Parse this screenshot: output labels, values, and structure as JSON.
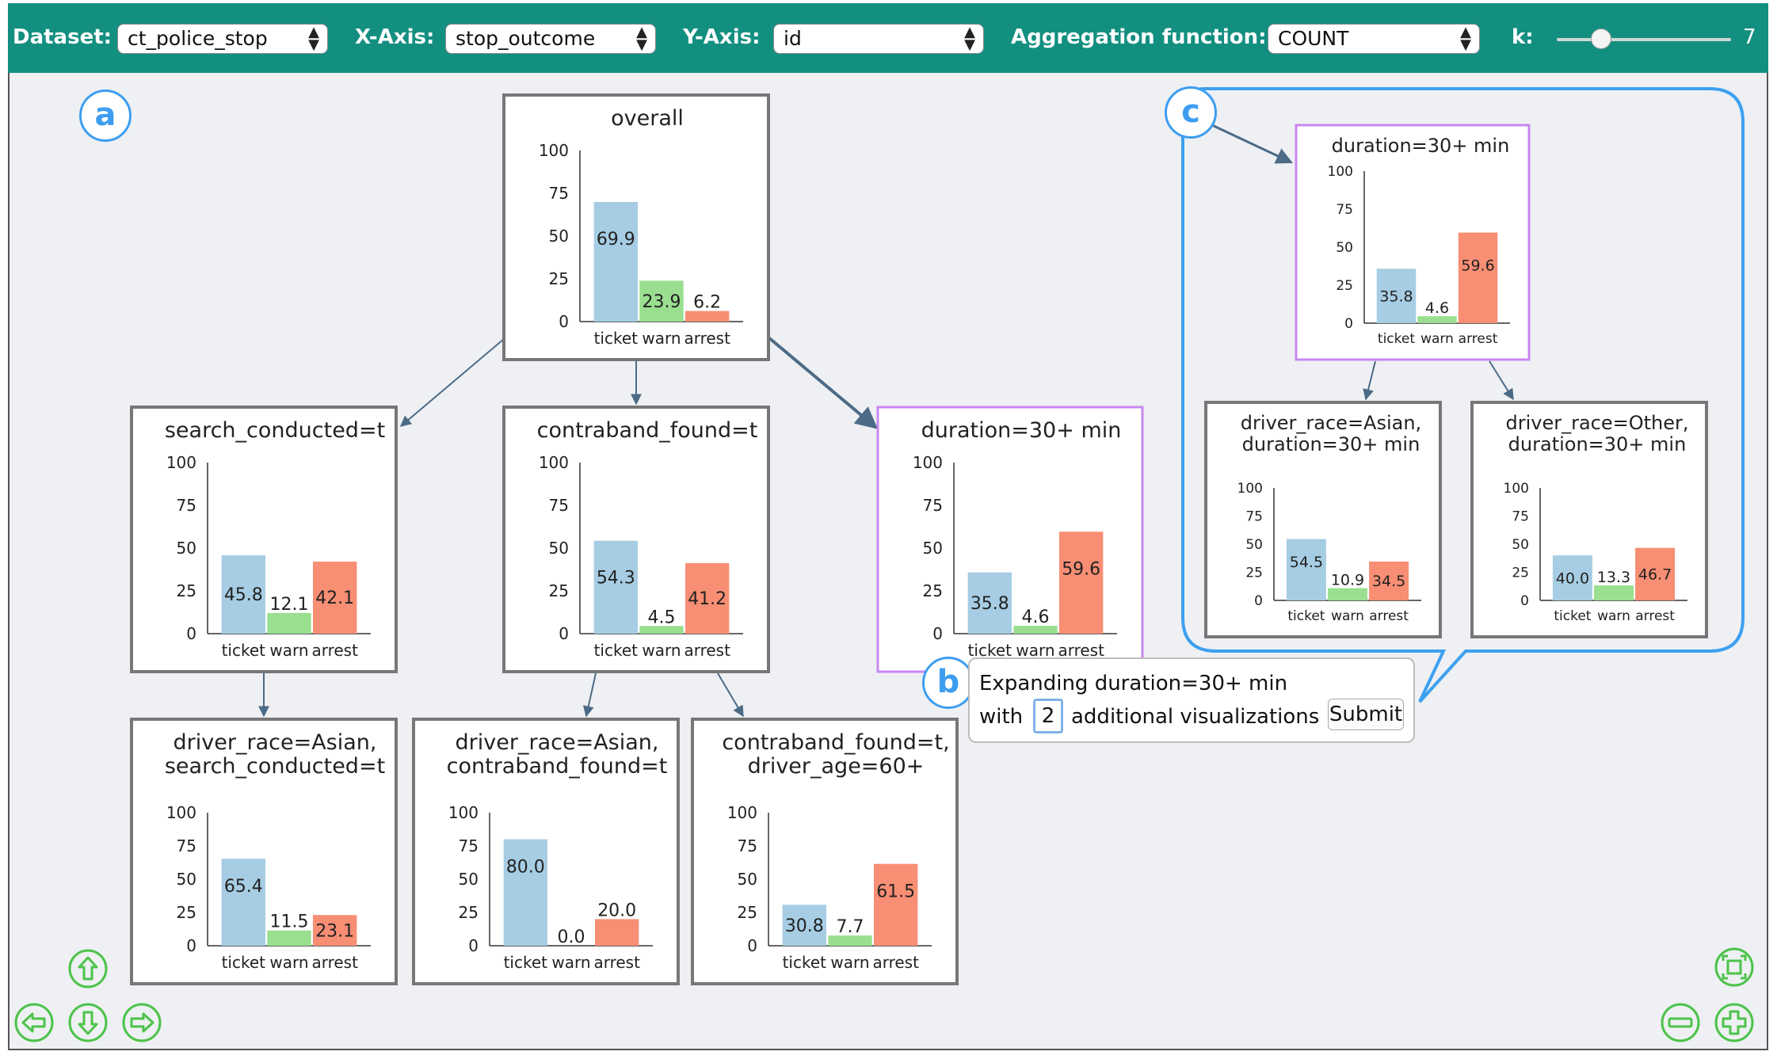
{
  "toolbar": {
    "dataset_label": "Dataset:",
    "dataset_value": "ct_police_stop",
    "xaxis_label": "X-Axis:",
    "xaxis_value": "stop_outcome",
    "yaxis_label": "Y-Axis:",
    "yaxis_value": "id",
    "agg_label": "Aggregation function:",
    "agg_value": "COUNT",
    "k_label": "k:",
    "k_value": "7"
  },
  "annotations": {
    "a": "a",
    "b": "b",
    "c": "c"
  },
  "popup": {
    "line1": "Expanding duration=30+ min",
    "with": "with",
    "count": "2",
    "after": "additional visualizations",
    "submit": "Submit"
  },
  "colors": {
    "ticket": "#a6cde3",
    "warn": "#99df8f",
    "arrest": "#f88e74",
    "node_border": "#777777",
    "highlight": "#c987f0",
    "expansion": "#3da0f0",
    "edge": "#4c6b86",
    "toolbar": "#138f80"
  },
  "chart_data": [
    {
      "id": "overall",
      "type": "bar",
      "title": [
        "overall"
      ],
      "categories": [
        "ticket",
        "warn",
        "arrest"
      ],
      "values": [
        69.9,
        23.9,
        6.2
      ],
      "labels": [
        "69.9",
        "23.9",
        "6.2"
      ],
      "yticks": [
        "0",
        "25",
        "50",
        "75",
        "100"
      ],
      "ylim": [
        0,
        100
      ]
    },
    {
      "id": "search_conducted",
      "type": "bar",
      "title": [
        "search_conducted=t"
      ],
      "categories": [
        "ticket",
        "warn",
        "arrest"
      ],
      "values": [
        45.8,
        12.1,
        42.1
      ],
      "labels": [
        "45.8",
        "12.1",
        "42.1"
      ],
      "yticks": [
        "0",
        "25",
        "50",
        "75",
        "100"
      ],
      "ylim": [
        0,
        100
      ]
    },
    {
      "id": "contraband_found",
      "type": "bar",
      "title": [
        "contraband_found=t"
      ],
      "categories": [
        "ticket",
        "warn",
        "arrest"
      ],
      "values": [
        54.3,
        4.5,
        41.2
      ],
      "labels": [
        "54.3",
        "4.5",
        "41.2"
      ],
      "yticks": [
        "0",
        "25",
        "50",
        "75",
        "100"
      ],
      "ylim": [
        0,
        100
      ]
    },
    {
      "id": "duration",
      "type": "bar",
      "title": [
        "duration=30+ min"
      ],
      "categories": [
        "ticket",
        "warn",
        "arrest"
      ],
      "values": [
        35.8,
        4.6,
        59.6
      ],
      "labels": [
        "35.8",
        "4.6",
        "59.6"
      ],
      "yticks": [
        "0",
        "25",
        "50",
        "75",
        "100"
      ],
      "ylim": [
        0,
        100
      ]
    },
    {
      "id": "asian_search",
      "type": "bar",
      "title": [
        "driver_race=Asian,",
        "search_conducted=t"
      ],
      "categories": [
        "ticket",
        "warn",
        "arrest"
      ],
      "values": [
        65.4,
        11.5,
        23.1
      ],
      "labels": [
        "65.4",
        "11.5",
        "23.1"
      ],
      "yticks": [
        "0",
        "25",
        "50",
        "75",
        "100"
      ],
      "ylim": [
        0,
        100
      ]
    },
    {
      "id": "asian_contraband",
      "type": "bar",
      "title": [
        "driver_race=Asian,",
        "contraband_found=t"
      ],
      "categories": [
        "ticket",
        "warn",
        "arrest"
      ],
      "values": [
        80.0,
        0.0,
        20.0
      ],
      "labels": [
        "80.0",
        "0.0",
        "20.0"
      ],
      "yticks": [
        "0",
        "25",
        "50",
        "75",
        "100"
      ],
      "ylim": [
        0,
        100
      ]
    },
    {
      "id": "contraband_age",
      "type": "bar",
      "title": [
        "contraband_found=t,",
        "driver_age=60+"
      ],
      "categories": [
        "ticket",
        "warn",
        "arrest"
      ],
      "values": [
        30.8,
        7.7,
        61.5
      ],
      "labels": [
        "30.8",
        "7.7",
        "61.5"
      ],
      "yticks": [
        "0",
        "25",
        "50",
        "75",
        "100"
      ],
      "ylim": [
        0,
        100
      ]
    },
    {
      "id": "c_duration",
      "type": "bar",
      "title": [
        "duration=30+ min"
      ],
      "categories": [
        "ticket",
        "warn",
        "arrest"
      ],
      "values": [
        35.8,
        4.6,
        59.6
      ],
      "labels": [
        "35.8",
        "4.6",
        "59.6"
      ],
      "yticks": [
        "0",
        "25",
        "50",
        "75",
        "100"
      ],
      "ylim": [
        0,
        100
      ]
    },
    {
      "id": "c_asian_duration",
      "type": "bar",
      "title": [
        "driver_race=Asian,",
        "duration=30+ min"
      ],
      "categories": [
        "ticket",
        "warn",
        "arrest"
      ],
      "values": [
        54.5,
        10.9,
        34.5
      ],
      "labels": [
        "54.5",
        "10.9",
        "34.5"
      ],
      "yticks": [
        "0",
        "25",
        "50",
        "75",
        "100"
      ],
      "ylim": [
        0,
        100
      ]
    },
    {
      "id": "c_other_duration",
      "type": "bar",
      "title": [
        "driver_race=Other,",
        "duration=30+ min"
      ],
      "categories": [
        "ticket",
        "warn",
        "arrest"
      ],
      "values": [
        40.0,
        13.3,
        46.7
      ],
      "labels": [
        "40.0",
        "13.3",
        "46.7"
      ],
      "yticks": [
        "0",
        "25",
        "50",
        "75",
        "100"
      ],
      "ylim": [
        0,
        100
      ]
    }
  ],
  "edges": [
    [
      "overall",
      "search_conducted"
    ],
    [
      "overall",
      "contraband_found"
    ],
    [
      "overall",
      "duration"
    ],
    [
      "search_conducted",
      "asian_search"
    ],
    [
      "contraband_found",
      "asian_contraband"
    ],
    [
      "contraband_found",
      "contraband_age"
    ],
    [
      "c_duration",
      "c_asian_duration"
    ],
    [
      "c_duration",
      "c_other_duration"
    ]
  ],
  "nav": [
    "pan-up-icon",
    "pan-left-icon",
    "pan-down-icon",
    "pan-right-icon",
    "fit-view-icon",
    "zoom-out-icon",
    "zoom-in-icon"
  ]
}
